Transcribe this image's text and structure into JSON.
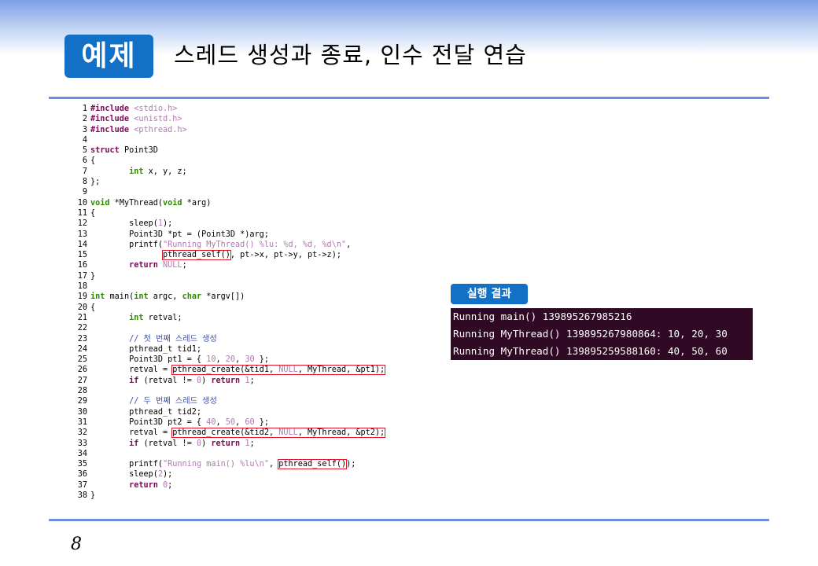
{
  "header": {
    "badge": "예제",
    "title": "스레드 생성과 종료, 인수 전달 연습"
  },
  "code_lines": [
    {
      "n": "1",
      "html": "<span class=\"kw-dark\">#include</span> <span class=\"str\">&lt;stdio.h&gt;</span>"
    },
    {
      "n": "2",
      "html": "<span class=\"kw-dark\">#include</span> <span class=\"str\">&lt;unistd.h&gt;</span>"
    },
    {
      "n": "3",
      "html": "<span class=\"kw-dark\">#include</span> <span class=\"str\">&lt;pthread.h&gt;</span>"
    },
    {
      "n": "4",
      "html": ""
    },
    {
      "n": "5",
      "html": "<span class=\"kw-dark\">struct</span> Point3D"
    },
    {
      "n": "6",
      "html": "{"
    },
    {
      "n": "7",
      "html": "        <span class=\"kw-green\">int</span> x, y, z;"
    },
    {
      "n": "8",
      "html": "};"
    },
    {
      "n": "9",
      "html": ""
    },
    {
      "n": "10",
      "html": "<span class=\"kw-green\">void</span> *MyThread(<span class=\"kw-green\">void</span> *arg)"
    },
    {
      "n": "11",
      "html": "{"
    },
    {
      "n": "12",
      "html": "        sleep(<span class=\"num\">1</span>);"
    },
    {
      "n": "13",
      "html": "        Point3D *pt = (Point3D *)arg;"
    },
    {
      "n": "14",
      "html": "        printf(<span class=\"str\">\"Running MyThread() %lu: %d, %d, %d\\n\"</span>,"
    },
    {
      "n": "15",
      "html": "               <span class=\"box\">pthread_self()</span>, pt-&gt;x, pt-&gt;y, pt-&gt;z);"
    },
    {
      "n": "16",
      "html": "        <span class=\"kw-dark\">return</span> <span class=\"num\">NULL</span>;"
    },
    {
      "n": "17",
      "html": "}"
    },
    {
      "n": "18",
      "html": ""
    },
    {
      "n": "19",
      "html": "<span class=\"kw-green\">int</span> main(<span class=\"kw-green\">int</span> argc, <span class=\"kw-green\">char</span> *argv[])"
    },
    {
      "n": "20",
      "html": "{"
    },
    {
      "n": "21",
      "html": "        <span class=\"kw-green\">int</span> retval;"
    },
    {
      "n": "22",
      "html": ""
    },
    {
      "n": "23",
      "html": "        <span class=\"cmt\">// 첫 번째 스레드 생성</span>"
    },
    {
      "n": "24",
      "html": "        pthread_t tid1;"
    },
    {
      "n": "25",
      "html": "        Point3D pt1 = { <span class=\"num\">10</span>, <span class=\"num\">20</span>, <span class=\"num\">30</span> };"
    },
    {
      "n": "26",
      "html": "        retval = <span class=\"box\">pthread_create(&amp;tid1, <span class=\"num\">NULL</span>, MyThread, &amp;pt1);</span>"
    },
    {
      "n": "27",
      "html": "        <span class=\"kw-dark\">if</span> (retval != <span class=\"num\">0</span>) <span class=\"kw-dark\">return</span> <span class=\"num\">1</span>;"
    },
    {
      "n": "28",
      "html": ""
    },
    {
      "n": "29",
      "html": "        <span class=\"cmt\">// 두 번째 스레드 생성</span>"
    },
    {
      "n": "30",
      "html": "        pthread_t tid2;"
    },
    {
      "n": "31",
      "html": "        Point3D pt2 = { <span class=\"num\">40</span>, <span class=\"num\">50</span>, <span class=\"num\">60</span> };"
    },
    {
      "n": "32",
      "html": "        retval = <span class=\"box\">pthread_create(&amp;tid2, <span class=\"num\">NULL</span>, MyThread, &amp;pt2);</span>"
    },
    {
      "n": "33",
      "html": "        <span class=\"kw-dark\">if</span> (retval != <span class=\"num\">0</span>) <span class=\"kw-dark\">return</span> <span class=\"num\">1</span>;"
    },
    {
      "n": "34",
      "html": ""
    },
    {
      "n": "35",
      "html": "        printf(<span class=\"str\">\"Running main() %lu\\n\"</span>, <span class=\"box\">pthread_self()</span>);"
    },
    {
      "n": "36",
      "html": "        sleep(<span class=\"num\">2</span>);"
    },
    {
      "n": "37",
      "html": "        <span class=\"kw-dark\">return</span> <span class=\"num\">0</span>;"
    },
    {
      "n": "38",
      "html": "}"
    }
  ],
  "result": {
    "label": "실행 결과",
    "lines": [
      "Running main() 139895267985216",
      "Running MyThread() 139895267980864: 10, 20, 30",
      "Running MyThread() 139895259588160: 40, 50, 60"
    ]
  },
  "page_number": "8",
  "colors": {
    "accent": "#1270c6",
    "rule": "#6b8fe0",
    "terminal_bg": "#300a24",
    "highlight_box": "#e0162b"
  }
}
